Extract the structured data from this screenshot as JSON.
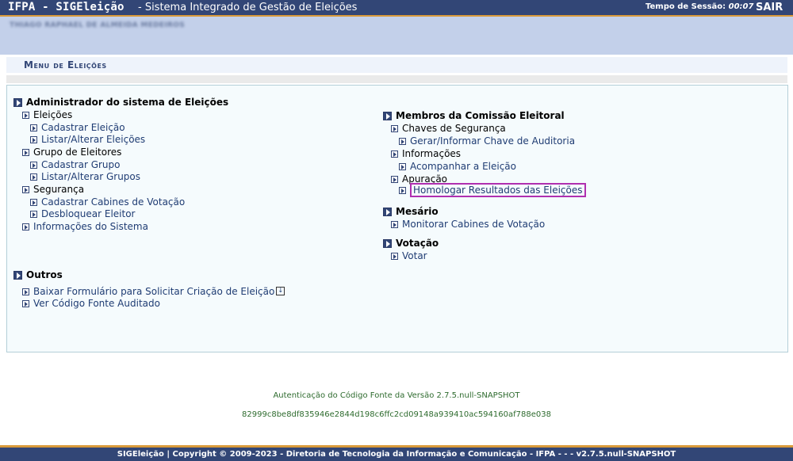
{
  "header": {
    "brand": "IFPA - SIGEleição",
    "subtitle": "- Sistema Integrado de Gestão de Eleições",
    "session_label": "Tempo de Sessão:",
    "session_time": "00:07",
    "logout": "SAIR"
  },
  "user": {
    "name": "THIAGO RAPHAEL DE ALMEIDA MEDEIROS"
  },
  "page": {
    "title": "Menu de Eleições"
  },
  "admin": {
    "heading": "Administrador do sistema de Eleições",
    "eleicoes": "Eleições",
    "cadastrar_eleicao": "Cadastrar Eleição",
    "listar_eleicoes": "Listar/Alterar Eleições",
    "grupo": "Grupo de Eleitores",
    "cadastrar_grupo": "Cadastrar Grupo",
    "listar_grupos": "Listar/Alterar Grupos",
    "seguranca": "Segurança",
    "cadastrar_cabines": "Cadastrar Cabines de Votação",
    "desbloquear": "Desbloquear Eleitor",
    "informacoes_sistema": "Informações do Sistema"
  },
  "comissao": {
    "heading": "Membros da Comissão Eleitoral",
    "chaves": "Chaves de Segurança",
    "gerar_chave": "Gerar/Informar Chave de Auditoria",
    "informacoes": "Informações",
    "acompanhar": "Acompanhar a Eleição",
    "apuracao": "Apuração",
    "homologar": "Homologar Resultados das Eleições"
  },
  "mesario": {
    "heading": "Mesário",
    "monitorar": "Monitorar Cabines de Votação"
  },
  "votacao": {
    "heading": "Votação",
    "votar": "Votar"
  },
  "outros": {
    "heading": "Outros",
    "baixar": "Baixar Formulário para Solicitar Criação de Eleição",
    "codigo_fonte": "Ver Código Fonte Auditado"
  },
  "footer": {
    "auth": "Autenticação do Código Fonte da Versão 2.7.5.null-SNAPSHOT",
    "hash": "82999c8be8df835946e2844d198c6ffc2cd09148a939410ac594160af788e038",
    "copyright": "SIGEleição | Copyright © 2009-2023 - Diretoria de Tecnologia da Informação e Comunicação - IFPA - - - v2.7.5.null-SNAPSHOT"
  },
  "icons": [
    "arrow-bullet-icon",
    "download-icon"
  ],
  "colors": {
    "header_bg": "#324676",
    "accent": "#d99a3a",
    "link": "#1f3c73",
    "highlight": "#b02fb0"
  }
}
